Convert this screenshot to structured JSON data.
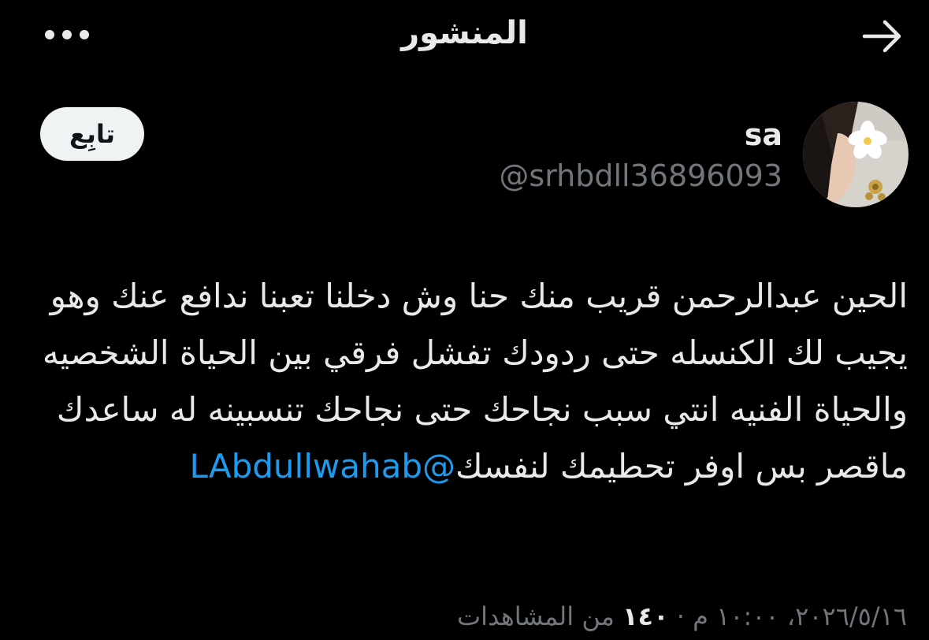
{
  "header": {
    "title": "المنشور",
    "more_icon": "more-horizontal-icon",
    "back_icon": "arrow-right-icon"
  },
  "author": {
    "display_name": "sa",
    "handle": "@srhbdll36896093",
    "follow_label": "تابِع"
  },
  "tweet": {
    "text": "الحين عبدالرحمن قريب منك حنا وش دخلنا تعبنا ندافع عنك وهو يجيب لك الكنسله حتى ردودك تفشل فرقي بين الحياة الشخصيه والحياة الفنيه انتي سبب نجاحك حتى نجاحك تنسبينه له ساعدك ماقصر بس اوفر تحطيمك لنفسك",
    "mention": "@LAbdullwahab"
  },
  "meta": {
    "timestamp": "٢٠٢٦/٥/١٦، ١٠:٠٠ م",
    "views_count": "١٤٠",
    "views_label": "من المشاهدات"
  },
  "colors": {
    "background": "#000000",
    "text_primary": "#e7e9ea",
    "text_secondary": "#71767b",
    "link": "#1d9bf0",
    "button_bg": "#eff3f4"
  }
}
